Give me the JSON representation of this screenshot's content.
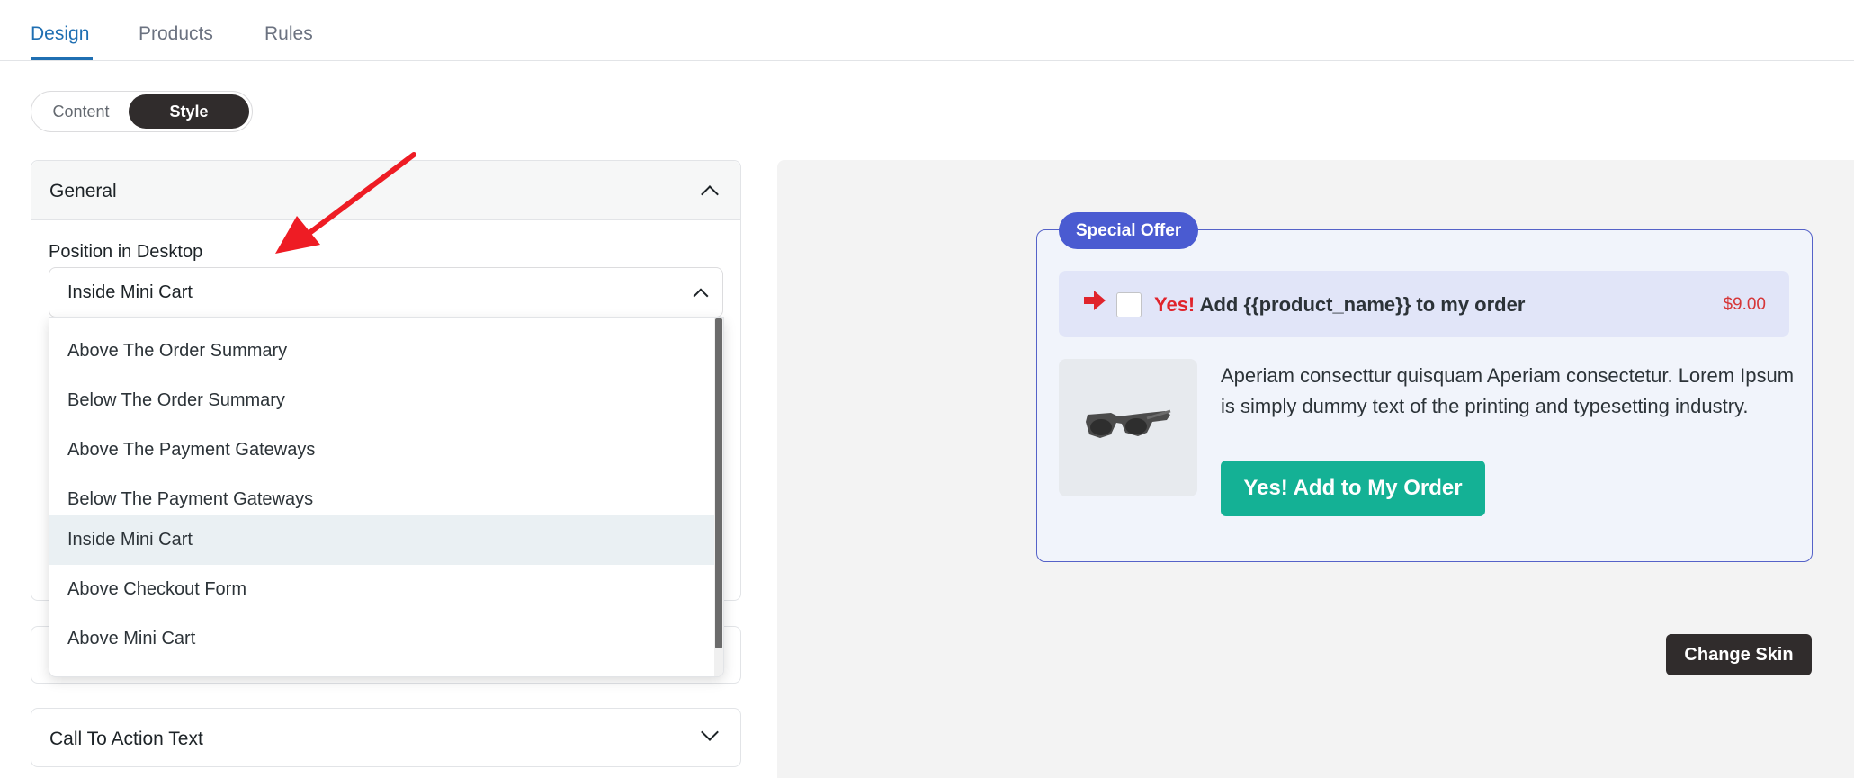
{
  "tabs": [
    {
      "label": "Design",
      "active": true
    },
    {
      "label": "Products",
      "active": false
    },
    {
      "label": "Rules",
      "active": false
    }
  ],
  "mode_toggle": {
    "content_label": "Content",
    "style_label": "Style",
    "selected": "Style"
  },
  "general_section": {
    "title": "General",
    "position_label": "Position in Desktop",
    "selected_value": "Inside Mini Cart",
    "options": [
      "Above The Order Summary",
      "Below The Order Summary",
      "Above The Payment Gateways",
      "Below The Payment Gateways",
      "Inside Mini Cart",
      "Above Checkout Form",
      "Above Mini Cart"
    ]
  },
  "cta_section": {
    "title": "Call To Action Text"
  },
  "preview": {
    "badge": "Special Offer",
    "row_yes": "Yes!",
    "row_text": "Add {{product_name}} to my order",
    "price": "$9.00",
    "description": "Aperiam consecttur quisquam Aperiam consectetur. Lorem Ipsum is simply dummy text of the printing and typesetting industry.",
    "add_button": "Yes! Add to My Order",
    "change_skin": "Change Skin"
  },
  "colors": {
    "accent_tab": "#1f6fb2",
    "badge": "#4a5bd1",
    "add_button": "#14b195",
    "price": "#d63638",
    "annotation_arrow": "#ee1c24"
  },
  "icons": [
    "chevron-up-icon",
    "chevron-down-icon",
    "right-arrow-icon",
    "sunglasses-image",
    "annotation-arrow"
  ]
}
